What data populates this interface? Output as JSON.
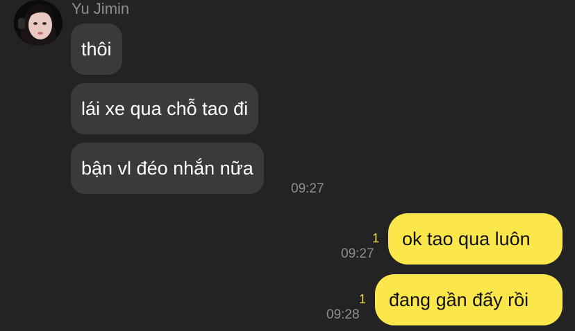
{
  "contact": {
    "name": "Yu Jimin"
  },
  "incoming_messages": [
    {
      "text": "thôi"
    },
    {
      "text": "lái xe qua chỗ tao đi"
    },
    {
      "text": "bận vl đéo nhắn nữa"
    }
  ],
  "incoming_time": "09:27",
  "outgoing_messages": [
    {
      "text": "ok tao qua luôn",
      "unread": "1",
      "time": "09:27"
    },
    {
      "text": "đang gần đấy rồi",
      "unread": "1",
      "time": "09:28"
    }
  ],
  "colors": {
    "background": "#232326",
    "incoming_bubble": "#3a3a3c",
    "outgoing_bubble": "#fbe74a",
    "unread_count": "#f5d84a",
    "timestamp": "#8e8e93"
  }
}
